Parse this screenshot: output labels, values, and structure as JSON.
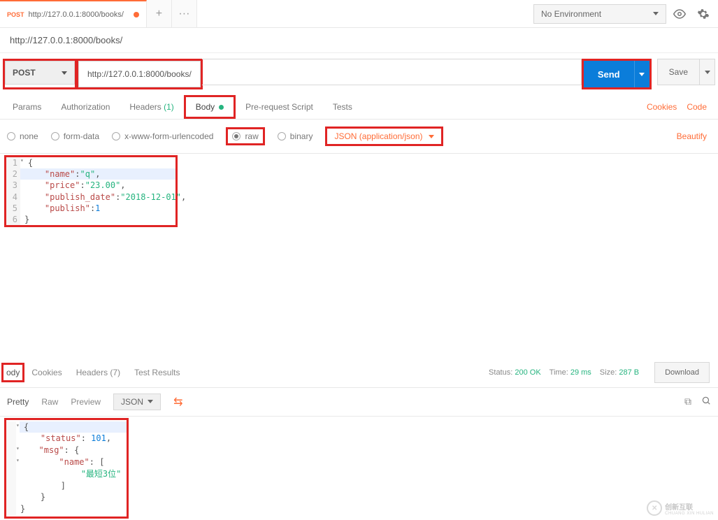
{
  "topbar": {
    "tab": {
      "method": "POST",
      "title": "http://127.0.0.1:8000/books/",
      "dirty": true
    },
    "plus_label": "+",
    "more_label": "···",
    "env_label": "No Environment"
  },
  "url_display": "http://127.0.0.1:8000/books/",
  "request": {
    "method": "POST",
    "url": "http://127.0.0.1:8000/books/",
    "send_label": "Send",
    "save_label": "Save"
  },
  "req_tabs": {
    "params": "Params",
    "auth": "Authorization",
    "headers": "Headers",
    "headers_count": "(1)",
    "body": "Body",
    "prs": "Pre-request Script",
    "tests": "Tests",
    "cookies": "Cookies",
    "code": "Code"
  },
  "body_opts": {
    "none": "none",
    "form_data": "form-data",
    "urlenc": "x-www-form-urlencoded",
    "raw": "raw",
    "binary": "binary",
    "json_sel": "JSON (application/json)",
    "beautify": "Beautify"
  },
  "editor": {
    "l1": "{",
    "l2_k": "\"name\"",
    "l2_v": "\"q\"",
    "l3_k": "\"price\"",
    "l3_v": "\"23.00\"",
    "l4_k": "\"publish_date\"",
    "l4_v": "\"2018-12-01\"",
    "l5_k": "\"publish\"",
    "l5_v": "1",
    "l6": "}"
  },
  "resp_tabs": {
    "body": "ody",
    "cookies": "Cookies",
    "headers": "Headers",
    "headers_count": "(7)",
    "test_results": "Test Results"
  },
  "resp_stats": {
    "status_l": "Status:",
    "status_v": "200 OK",
    "time_l": "Time:",
    "time_v": "29 ms",
    "size_l": "Size:",
    "size_v": "287 B",
    "download": "Download"
  },
  "resp_view": {
    "pretty": "Pretty",
    "raw": "Raw",
    "preview": "Preview",
    "json": "JSON"
  },
  "resp_body": {
    "l1": "{",
    "l2_k": "\"status\"",
    "l2_v": "101",
    "l3_k": "\"msg\"",
    "l3_v": "{",
    "l4_k": "\"name\"",
    "l4_v": "[",
    "l5": "\"最短3位\"",
    "l6": "]",
    "l7": "}",
    "l8": "}"
  },
  "watermark": {
    "brand": "创新互联",
    "sub": "CHUANG XIN HULIAN"
  }
}
